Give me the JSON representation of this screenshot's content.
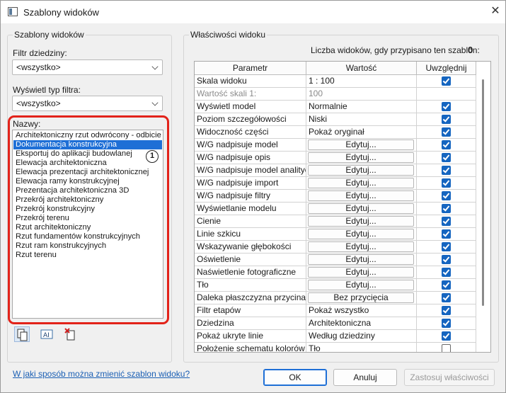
{
  "window": {
    "title": "Szablony widoków"
  },
  "left_panel": {
    "group_title": "Szablony widoków",
    "discipline_filter": {
      "label": "Filtr dziedziny:",
      "value": "<wszystko>"
    },
    "view_type_filter": {
      "label": "Wyświetl typ filtra:",
      "value": "<wszystko>"
    },
    "names": {
      "label": "Nazwy:",
      "items": [
        "Architektoniczny rzut odwrócony - odbicie",
        "Dokumentacja konstrukcyjna",
        "Eksportuj do aplikacji budowlanej",
        "Elewacja architektoniczna",
        "Elewacja prezentacji architektonicznej",
        "Elewacja ramy konstrukcyjnej",
        "Prezentacja architektoniczna 3D",
        "Przekrój architektoniczny",
        "Przekrój konstrukcyjny",
        "Przekrój terenu",
        "Rzut architektoniczny",
        "Rzut fundamentów konstrukcyjnych",
        "Rzut ram konstrukcyjnych",
        "Rzut terenu"
      ],
      "selected_index": 1
    },
    "callout_number": "1"
  },
  "help_link": "W jaki sposób można zmienić szablon widoku?",
  "right_panel": {
    "group_title": "Właściwości widoku",
    "count_label": "Liczba widoków, gdy przypisano ten szablon:",
    "count_value": "0",
    "columns": [
      "Parametr",
      "Wartość",
      "Uwzględnij"
    ],
    "rows": [
      {
        "param": "Skala widoku",
        "value": "1 : 100",
        "kind": "text",
        "include": true
      },
      {
        "param": "Wartość skali   1:",
        "value": "100",
        "kind": "text",
        "include": null,
        "dim": true
      },
      {
        "param": "Wyświetl model",
        "value": "Normalnie",
        "kind": "text",
        "include": true
      },
      {
        "param": "Poziom szczegółowości",
        "value": "Niski",
        "kind": "text",
        "include": true
      },
      {
        "param": "Widoczność części",
        "value": "Pokaż oryginał",
        "kind": "text",
        "include": true
      },
      {
        "param": "W/G nadpisuje model",
        "value": "Edytuj...",
        "kind": "button",
        "include": true
      },
      {
        "param": "W/G nadpisuje opis",
        "value": "Edytuj...",
        "kind": "button",
        "include": true
      },
      {
        "param": "W/G nadpisuje model analityczny",
        "value": "Edytuj...",
        "kind": "button",
        "include": true
      },
      {
        "param": "W/G nadpisuje import",
        "value": "Edytuj...",
        "kind": "button",
        "include": true
      },
      {
        "param": "W/G nadpisuje filtry",
        "value": "Edytuj...",
        "kind": "button",
        "include": true
      },
      {
        "param": "Wyświetlanie modelu",
        "value": "Edytuj...",
        "kind": "button",
        "include": true
      },
      {
        "param": "Cienie",
        "value": "Edytuj...",
        "kind": "button",
        "include": true
      },
      {
        "param": "Linie szkicu",
        "value": "Edytuj...",
        "kind": "button",
        "include": true
      },
      {
        "param": "Wskazywanie głębokości",
        "value": "Edytuj...",
        "kind": "button",
        "include": true
      },
      {
        "param": "Oświetlenie",
        "value": "Edytuj...",
        "kind": "button",
        "include": true
      },
      {
        "param": "Naświetlenie fotograficzne",
        "value": "Edytuj...",
        "kind": "button",
        "include": true
      },
      {
        "param": "Tło",
        "value": "Edytuj...",
        "kind": "button",
        "include": true
      },
      {
        "param": "Daleka płaszczyzna przycinania",
        "value": "Bez przycięcia",
        "kind": "button",
        "include": true
      },
      {
        "param": "Filtr etapów",
        "value": "Pokaż wszystko",
        "kind": "text",
        "include": true
      },
      {
        "param": "Dziedzina",
        "value": "Architektoniczna",
        "kind": "text",
        "include": true
      },
      {
        "param": "Pokaż ukryte linie",
        "value": "Według dziedziny",
        "kind": "text",
        "include": true
      },
      {
        "param": "Położenie schematu kolorów",
        "value": "Tło",
        "kind": "text",
        "include": false
      }
    ]
  },
  "buttons": {
    "ok": "OK",
    "cancel": "Anuluj",
    "apply": "Zastosuj właściwości"
  },
  "colors": {
    "accent": "#1e6fd6",
    "checkbox": "#1565c0",
    "highlight_frame": "#e2231a"
  }
}
